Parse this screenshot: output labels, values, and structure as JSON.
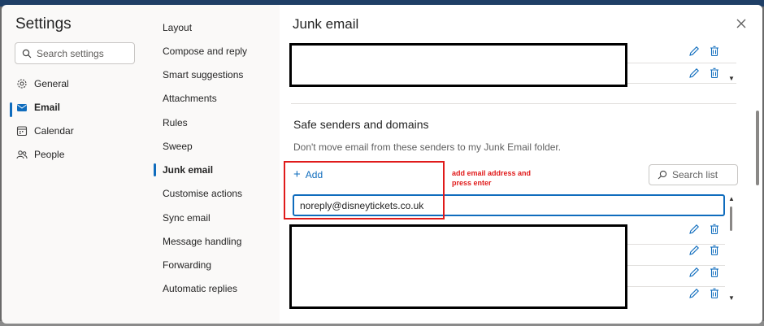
{
  "window": {
    "title": "Settings"
  },
  "search": {
    "placeholder": "Search settings"
  },
  "nav": {
    "items": [
      {
        "label": "General",
        "icon": "gear-icon"
      },
      {
        "label": "Email",
        "icon": "mail-icon",
        "active": true
      },
      {
        "label": "Calendar",
        "icon": "calendar-icon"
      },
      {
        "label": "People",
        "icon": "people-icon"
      }
    ]
  },
  "subnav": {
    "items": [
      "Layout",
      "Compose and reply",
      "Smart suggestions",
      "Attachments",
      "Rules",
      "Sweep",
      "Junk email",
      "Customise actions",
      "Sync email",
      "Message handling",
      "Forwarding",
      "Automatic replies"
    ],
    "active": "Junk email"
  },
  "panel": {
    "title": "Junk email",
    "safe_senders": {
      "title": "Safe senders and domains",
      "description": "Don't move email from these senders to my Junk Email folder.",
      "add_label": "Add",
      "search_list_label": "Search list",
      "input_value": "noreply@disneytickets.co.uk"
    },
    "annotation": "add email address and press enter"
  },
  "colors": {
    "accent": "#0f6cbd",
    "annotation": "#e01b1b"
  }
}
